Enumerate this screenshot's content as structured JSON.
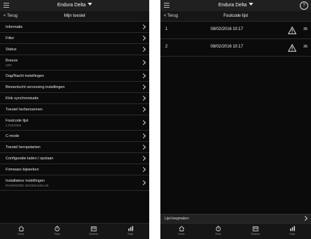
{
  "left": {
    "device_name": "Endura Delta",
    "back_label": "< Terug",
    "page_title": "Mijn toestel",
    "menu": [
      {
        "label": "Informatie",
        "sub": ""
      },
      {
        "label": "Filter",
        "sub": ""
      },
      {
        "label": "Status",
        "sub": ""
      },
      {
        "label": "Breeze",
        "sub": "OFF"
      },
      {
        "label": "Dag/Nacht instellingen",
        "sub": ""
      },
      {
        "label": "Binnenlucht verversing instellingen",
        "sub": ""
      },
      {
        "label": "Klok synchronisatie",
        "sub": ""
      },
      {
        "label": "Toestel herbenoemen",
        "sub": ""
      },
      {
        "label": "Foutcode lijst",
        "sub": "2 FOUTEN"
      },
      {
        "label": "C-mode",
        "sub": ""
      },
      {
        "label": "Toestel heropstarten",
        "sub": ""
      },
      {
        "label": "Configuratie laden / opslaan",
        "sub": ""
      },
      {
        "label": "Firmware bijwerken",
        "sub": ""
      },
      {
        "label": "Installateur instellingen",
        "sub": "PASWOORD NOODZAKELIJK"
      }
    ],
    "tabs": [
      {
        "label": "Home",
        "icon": "home-icon"
      },
      {
        "label": "Timer",
        "icon": "timer-icon"
      },
      {
        "label": "Schema",
        "icon": "schedule-icon"
      },
      {
        "label": "Data",
        "icon": "chart-icon"
      }
    ]
  },
  "right": {
    "device_name": "Endura Delta",
    "back_label": "< Terug",
    "page_title": "Foutcode lijst",
    "help_label": "?",
    "faults": [
      {
        "index": "1",
        "datetime": "08/02/2016  10:17",
        "code": "35"
      },
      {
        "index": "2",
        "datetime": "08/02/2016  10:17",
        "code": "36"
      }
    ],
    "clear_label": "Lijst leegmaken",
    "tabs": [
      {
        "label": "Home",
        "icon": "home-icon"
      },
      {
        "label": "Timer",
        "icon": "timer-icon"
      },
      {
        "label": "Schema",
        "icon": "schedule-icon"
      },
      {
        "label": "Data",
        "icon": "chart-icon"
      }
    ]
  }
}
